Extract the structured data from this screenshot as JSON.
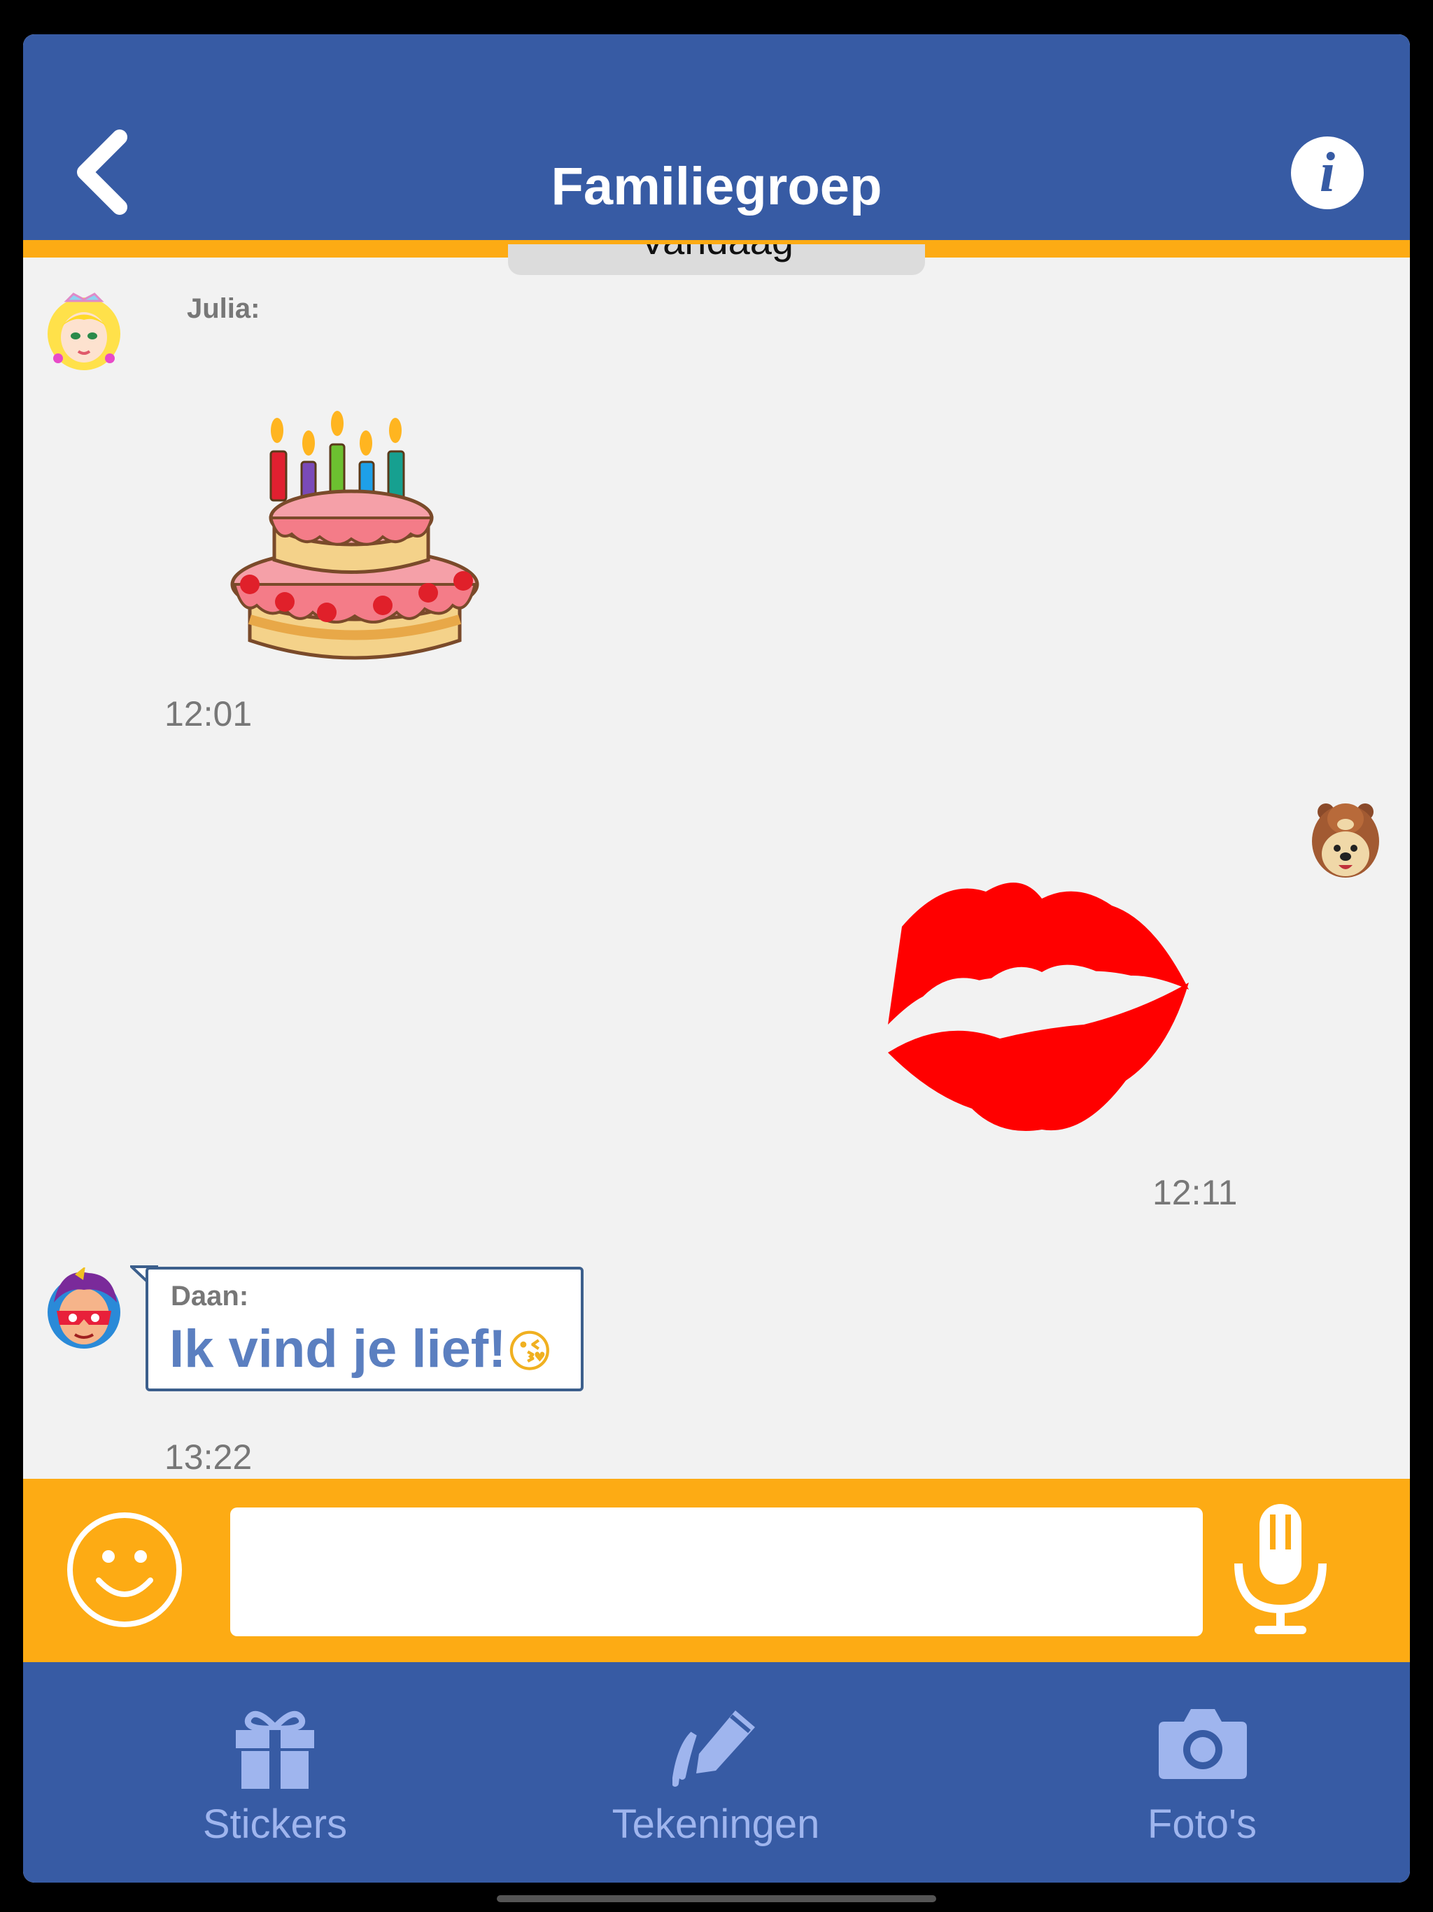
{
  "header": {
    "title": "Familiegroep",
    "back_icon": "chevron-left-icon",
    "info_icon": "info-icon",
    "info_label": "i"
  },
  "date_separator": "Vandaag",
  "messages": [
    {
      "sender": "Julia:",
      "type": "sticker",
      "sticker": "birthday-cake",
      "time": "12:01",
      "avatar": "princess-avatar"
    },
    {
      "sender": "",
      "type": "sticker",
      "sticker": "red-lips-kiss",
      "time": "12:11",
      "avatar": "bear-avatar",
      "outgoing": true
    },
    {
      "sender": "Daan:",
      "type": "text",
      "text": "Ik vind je lief!",
      "emoji": "😘",
      "time": "13:22",
      "avatar": "superhero-avatar"
    }
  ],
  "input": {
    "placeholder": "",
    "value": ""
  },
  "tabs": [
    {
      "label": "Stickers",
      "icon": "gift-icon"
    },
    {
      "label": "Tekeningen",
      "icon": "pencil-icon"
    },
    {
      "label": "Foto's",
      "icon": "camera-icon"
    }
  ],
  "colors": {
    "primary_blue": "#375ba4",
    "accent_orange": "#fdab14",
    "tab_text": "#9fb5ee",
    "message_text": "#5b7fc0"
  }
}
